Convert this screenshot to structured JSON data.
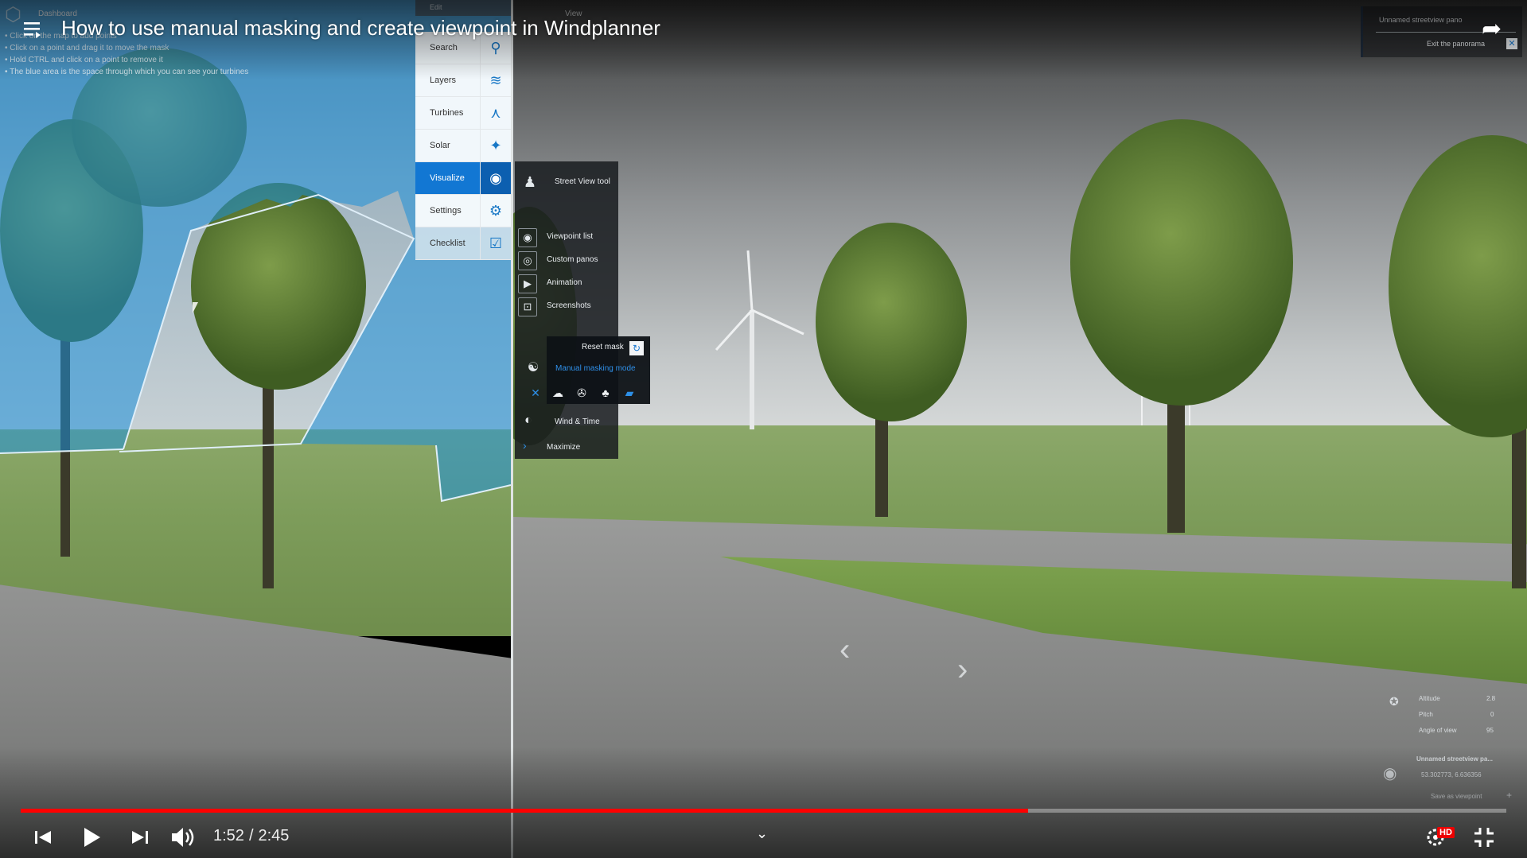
{
  "player": {
    "title": "How to use manual masking and create viewpoint in Windplanner",
    "current_time": "1:52",
    "duration": "2:45",
    "progress_fraction": 0.678,
    "hd_label": "HD",
    "accent_color": "#ff0000"
  },
  "app": {
    "dashboard_label": "Dashboard",
    "edit_label": "Edit",
    "view_label": "View",
    "instructions": [
      "• Click on the map to add points",
      "• Click on a point and drag it to move the mask",
      "• Hold CTRL and click on a point to remove it",
      "• The blue area is the space through which you can see your turbines"
    ],
    "menu": [
      {
        "label": "Search",
        "icon": "search-icon"
      },
      {
        "label": "Layers",
        "icon": "layers-icon"
      },
      {
        "label": "Turbines",
        "icon": "turbine-icon"
      },
      {
        "label": "Solar",
        "icon": "solar-icon"
      },
      {
        "label": "Visualize",
        "icon": "eye-icon",
        "active": true
      },
      {
        "label": "Settings",
        "icon": "gear-icon"
      },
      {
        "label": "Checklist",
        "icon": "checkbox-icon"
      }
    ],
    "visualize": {
      "street_view": "Street View tool",
      "viewpoint_list": "Viewpoint list",
      "custom_panos": "Custom panos",
      "animation": "Animation",
      "screenshots": "Screenshots",
      "reset_mask": "Reset mask",
      "manual_masking": "Manual masking mode",
      "wind_time": "Wind & Time",
      "maximize": "Maximize"
    },
    "pano": {
      "name": "Unnamed streetview pano",
      "exit": "Exit the panorama"
    },
    "info": {
      "altitude_label": "Altitude",
      "altitude_value": "2.8",
      "pitch_label": "Pitch",
      "pitch_value": "0",
      "angle_label": "Angle of view",
      "angle_value": "95",
      "viewpoint_name": "Unnamed streetview pa...",
      "coords": "53.302773, 6.636356",
      "save_viewpoint": "Save as viewpoint"
    },
    "mask_color": "#1e8fd8",
    "brand_color": "#1277d3"
  }
}
